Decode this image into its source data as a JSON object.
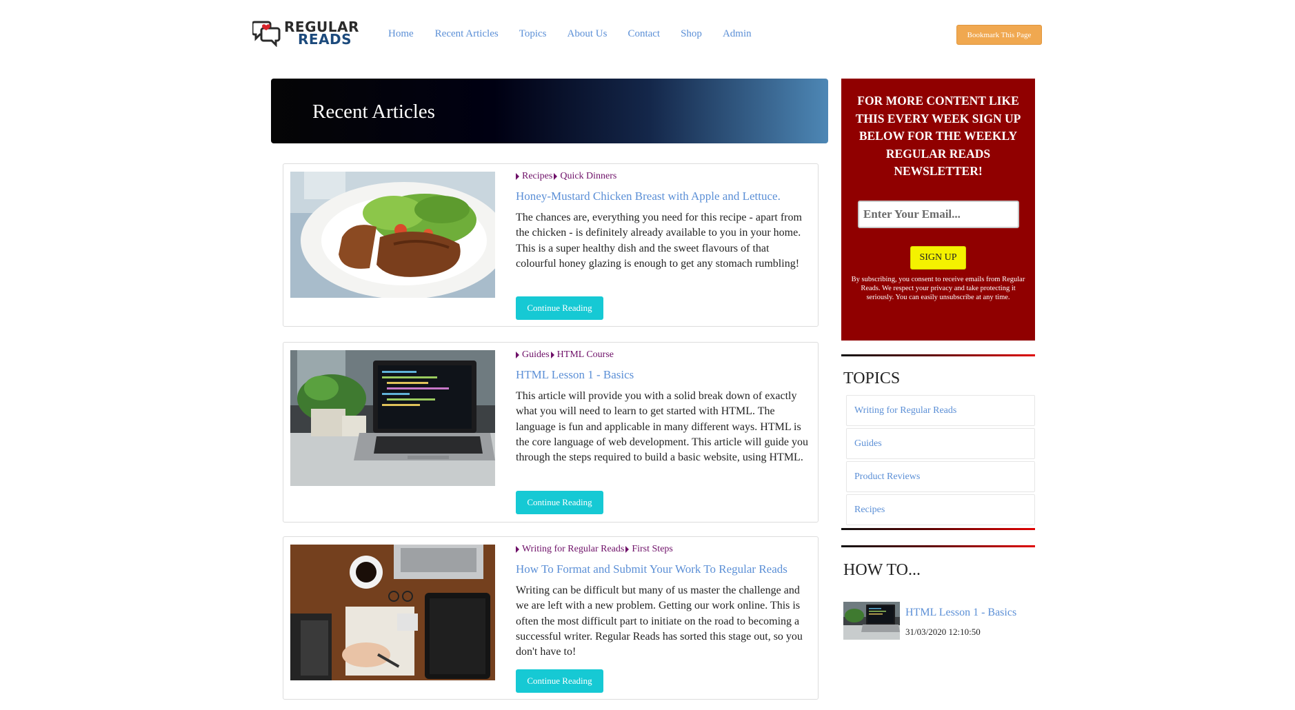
{
  "header": {
    "logo": {
      "line1": "REGULAR",
      "line2": "READS"
    },
    "nav": [
      "Home",
      "Recent Articles",
      "Topics",
      "About Us",
      "Contact",
      "Shop",
      "Admin"
    ],
    "bookmark_label": "Bookmark This Page"
  },
  "hero": {
    "title": "Recent Articles"
  },
  "articles": [
    {
      "category": "Recipes",
      "subcategory": "Quick Dinners",
      "title": "Honey-Mustard Chicken Breast with Apple and Lettuce.",
      "excerpt": "The chances are, everything you need for this recipe - apart from the chicken - is definitely already available to you in your home. This is a super healthy dish and the sweet flavours of that colourful honey glazing is enough to get any stomach rumbling!",
      "button": "Continue Reading"
    },
    {
      "category": "Guides",
      "subcategory": "HTML Course",
      "title": "HTML Lesson 1 - Basics",
      "excerpt": "This article will provide you with a solid break down of exactly what you will need to learn to get started with HTML. The language is fun and applicable in many different ways. HTML is the core language of web development. This article will guide you through the steps required to build a basic website, using HTML.",
      "button": "Continue Reading"
    },
    {
      "category": "Writing for Regular Reads",
      "subcategory": "First Steps",
      "title": "How To Format and Submit Your Work To Regular Reads",
      "excerpt": "Writing can be difficult but many of us master the challenge and we are left with a new problem. Getting our work online. This is often the most difficult part to initiate on the road to becoming a successful writer. Regular Reads has sorted this stage out, so you don't have to!",
      "button": "Continue Reading"
    }
  ],
  "newsletter": {
    "heading": "For more content like this every week sign up below for the weekly Regular Reads newsletter!",
    "email_placeholder": "Enter Your Email...",
    "signup_label": "SIGN UP",
    "note": "By subscribing, you consent to receive emails from Regular Reads. We respect your privacy and take protecting it seriously. You can easily unsubscribe at any time."
  },
  "topics": {
    "heading": "TOPICS",
    "items": [
      "Writing for Regular Reads",
      "Guides",
      "Product Reviews",
      "Recipes"
    ]
  },
  "howto": {
    "heading": "HOW TO...",
    "item": {
      "title": "HTML Lesson 1 - Basics",
      "date": "31/03/2020 12:10:50"
    }
  },
  "colors": {
    "link": "#5b8fd6",
    "category": "#6e1068",
    "cta": "#16c9d4",
    "newsletter_bg": "#900000",
    "signup": "#f4f200",
    "bookmark": "#f0a850"
  }
}
